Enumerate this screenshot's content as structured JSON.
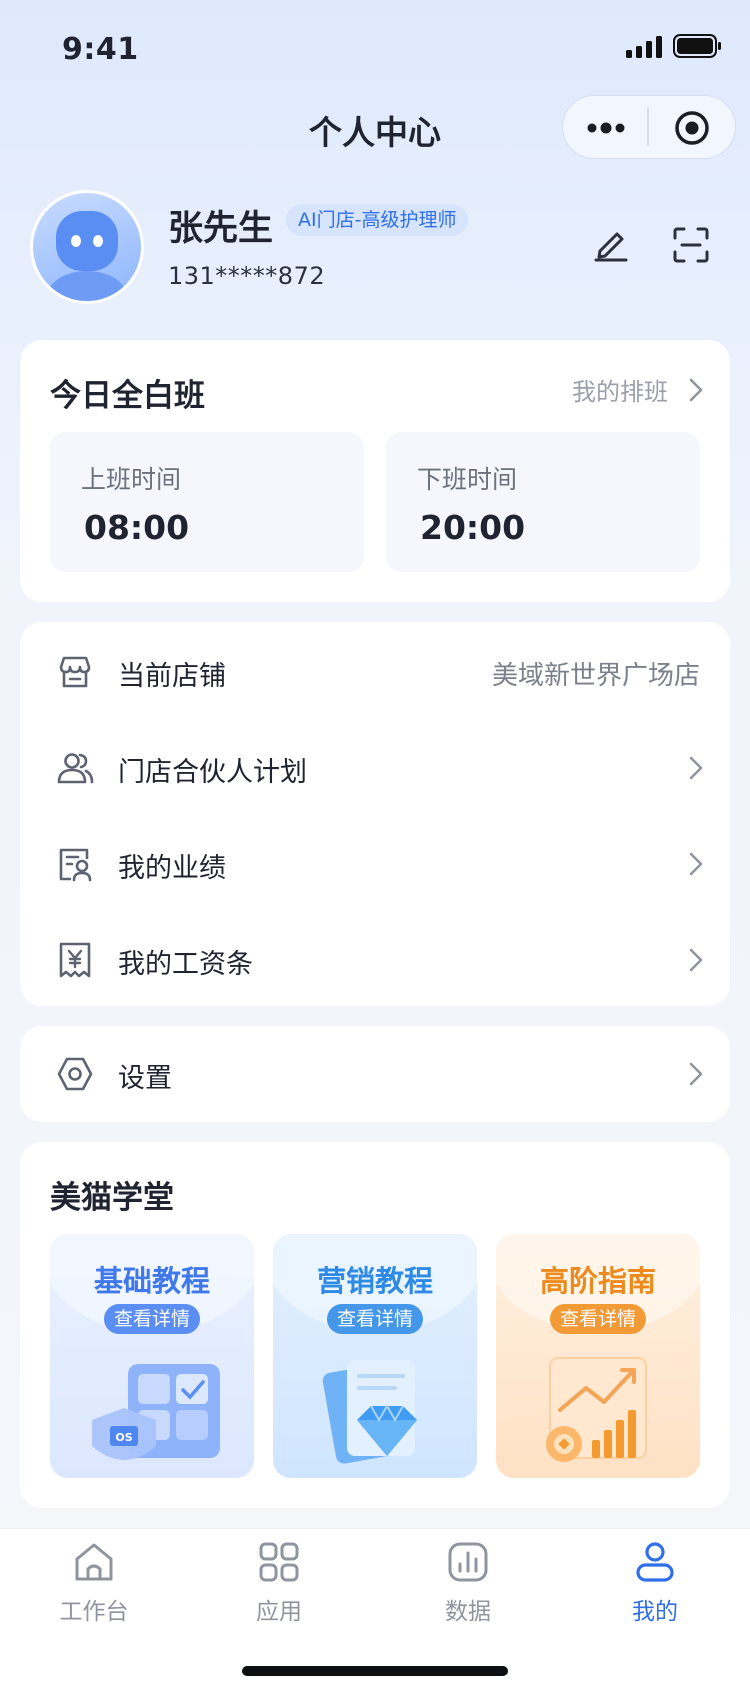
{
  "status_bar": {
    "time": "9:41"
  },
  "nav": {
    "title": "个人中心",
    "more_icon": "ellipsis-icon",
    "close_icon": "target-icon"
  },
  "profile": {
    "name": "张先生",
    "role": "AI门店-高级护理师",
    "phone": "131*****872"
  },
  "shift": {
    "title": "今日全白班",
    "schedule_link": "我的排班",
    "start_label": "上班时间",
    "start_time": "08:00",
    "end_label": "下班时间",
    "end_time": "20:00"
  },
  "menu": {
    "store_label": "当前店铺",
    "store_value": "美域新世界广场店",
    "partner_label": "门店合伙人计划",
    "performance_label": "我的业绩",
    "payslip_label": "我的工资条"
  },
  "settings": {
    "label": "设置"
  },
  "academy": {
    "title": "美猫学堂",
    "courses": [
      {
        "title": "基础教程",
        "button": "查看详情"
      },
      {
        "title": "营销教程",
        "button": "查看详情"
      },
      {
        "title": "高阶指南",
        "button": "查看详情"
      }
    ]
  },
  "tabbar": {
    "tabs": [
      {
        "label": "工作台"
      },
      {
        "label": "应用"
      },
      {
        "label": "数据"
      },
      {
        "label": "我的"
      }
    ],
    "active_color": "#2f6fe8",
    "inactive_color": "#8f949e"
  }
}
